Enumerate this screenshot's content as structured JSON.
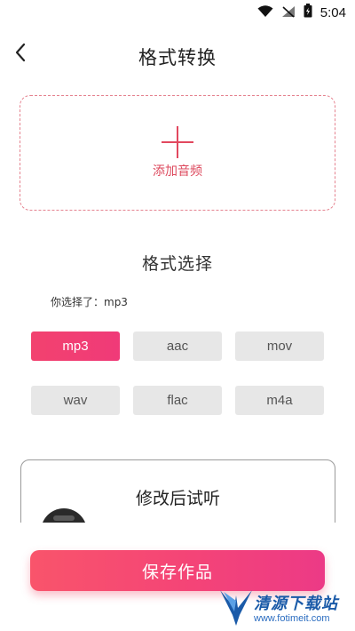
{
  "status_bar": {
    "time": "5:04"
  },
  "header": {
    "title": "格式转换"
  },
  "add_audio": {
    "label": "添加音频"
  },
  "format_section": {
    "title": "格式选择",
    "selected_text": "你选择了：mp3",
    "formats": [
      "mp3",
      "aac",
      "mov",
      "wav",
      "flac",
      "m4a"
    ],
    "selected": "mp3"
  },
  "preview": {
    "title": "修改后试听"
  },
  "save_button": {
    "label": "保存作品"
  },
  "watermark": {
    "name": "清源下载站",
    "url": "www.fotimeit.com"
  },
  "colors": {
    "accent": "#f2426f",
    "dashed_border": "#e5828f",
    "button_gray": "#e7e7e7"
  }
}
